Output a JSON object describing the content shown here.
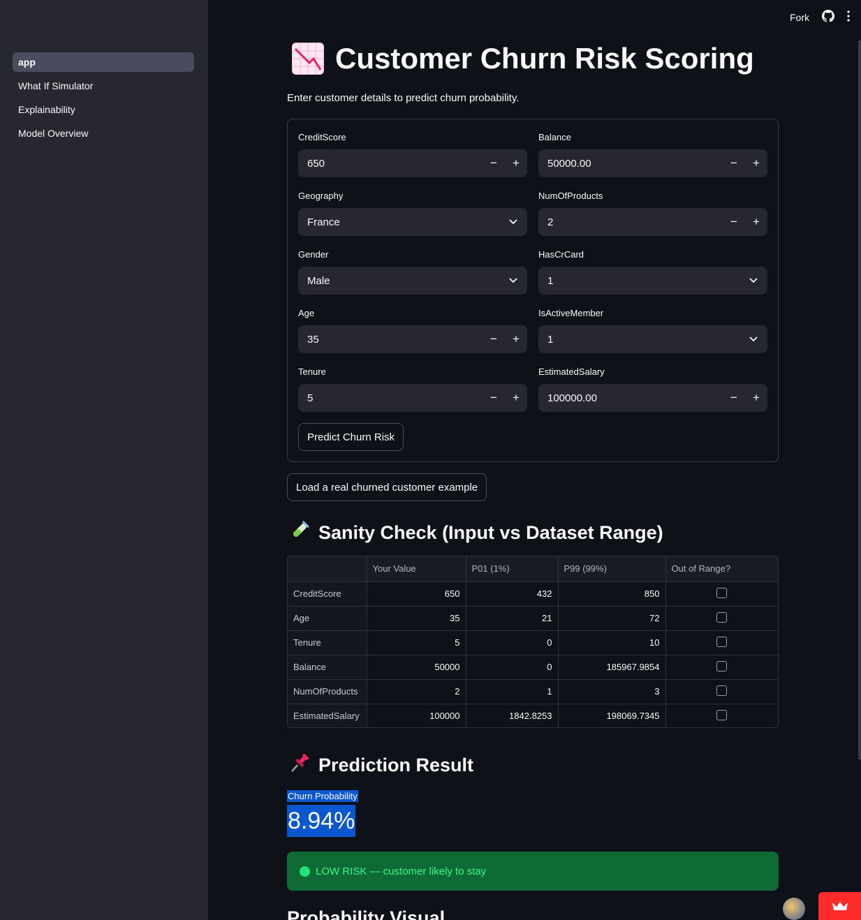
{
  "sidebar": {
    "items": [
      {
        "label": "app",
        "active": true
      },
      {
        "label": "What If Simulator"
      },
      {
        "label": "Explainability"
      },
      {
        "label": "Model Overview"
      }
    ]
  },
  "topbar": {
    "fork_label": "Fork",
    "github_icon": "github-icon",
    "menu_icon": "kebab-menu-icon"
  },
  "header": {
    "title": "Customer Churn Risk Scoring",
    "title_icon": "chart-decreasing-icon",
    "subtitle": "Enter customer details to predict churn probability."
  },
  "form": {
    "credit_score": {
      "label": "CreditScore",
      "value": "650"
    },
    "balance": {
      "label": "Balance",
      "value": "50000.00"
    },
    "geography": {
      "label": "Geography",
      "value": "France"
    },
    "num_products": {
      "label": "NumOfProducts",
      "value": "2"
    },
    "gender": {
      "label": "Gender",
      "value": "Male"
    },
    "has_cr_card": {
      "label": "HasCrCard",
      "value": "1"
    },
    "age": {
      "label": "Age",
      "value": "35"
    },
    "is_active": {
      "label": "IsActiveMember",
      "value": "1"
    },
    "tenure": {
      "label": "Tenure",
      "value": "5"
    },
    "salary": {
      "label": "EstimatedSalary",
      "value": "100000.00"
    },
    "minus": "−",
    "plus": "+",
    "predict_button": "Predict Churn Risk"
  },
  "load_example_button": "Load a real churned customer example",
  "sanity": {
    "title": "Sanity Check (Input vs Dataset Range)",
    "icon": "test-tube-icon",
    "columns": [
      "",
      "Your Value",
      "P01 (1%)",
      "P99 (99%)",
      "Out of Range?"
    ],
    "rows": [
      {
        "name": "CreditScore",
        "value": "650",
        "p01": "432",
        "p99": "850",
        "out_of_range": false
      },
      {
        "name": "Age",
        "value": "35",
        "p01": "21",
        "p99": "72",
        "out_of_range": false
      },
      {
        "name": "Tenure",
        "value": "5",
        "p01": "0",
        "p99": "10",
        "out_of_range": false
      },
      {
        "name": "Balance",
        "value": "50000",
        "p01": "0",
        "p99": "185967.9854",
        "out_of_range": false
      },
      {
        "name": "NumOfProducts",
        "value": "2",
        "p01": "1",
        "p99": "3",
        "out_of_range": false
      },
      {
        "name": "EstimatedSalary",
        "value": "100000",
        "p01": "1842.8253",
        "p99": "198069.7345",
        "out_of_range": false
      }
    ]
  },
  "result": {
    "title": "Prediction Result",
    "icon": "pushpin-icon",
    "metric_label": "Churn Probability",
    "metric_value": "8.94%",
    "alert": "LOW RISK — customer likely to stay",
    "next_section": "Probability Visual"
  },
  "colors": {
    "accent": "#0b57d0",
    "success_bg": "#0f6b36",
    "success_text": "#3ef58c",
    "sidebar": "#262730",
    "background": "#0e1117"
  }
}
